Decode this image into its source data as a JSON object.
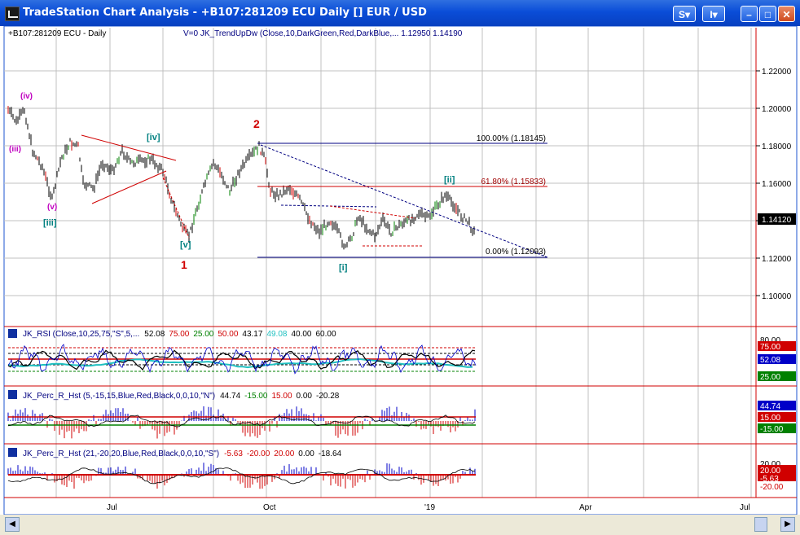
{
  "window": {
    "title": "TradeStation Chart Analysis  - +B107:281209 ECU Daily [] EUR / USD",
    "buttons": {
      "s": "S",
      "i": "I"
    }
  },
  "main_pane": {
    "symbol_label": "+B107:281209 ECU - Daily",
    "indicator_label": "V=0  JK_TrendUpDw (Close,10,DarkGreen,Red,DarkBlue,...  1.12950  1.14190",
    "y_ticks": [
      "1.22000",
      "1.20000",
      "1.18000",
      "1.16000",
      "1.14000",
      "1.12000",
      "1.10000"
    ],
    "last_price": "1.14120",
    "fib": [
      {
        "label": "100.00% (1.18145)",
        "value": 1.18145
      },
      {
        "label": "61.80% (1.15833)",
        "value": 1.15833
      },
      {
        "label": "0.00% (1.12093)",
        "value": 1.12093
      }
    ],
    "wave_labels": {
      "iv_small": "(iv)",
      "iii_small": "(iii)",
      "v_small": "(v)",
      "iii_bracket": "[iii]",
      "iv_bracket": "[iv]",
      "v_bracket": "[v]",
      "one": "1",
      "two": "2",
      "i_bracket": "[i]",
      "ii_bracket": "[ii]"
    }
  },
  "rsi_pane": {
    "label_prefix": "JK_RSI (Close,10,25,75,\"S\",5,...",
    "values": [
      {
        "text": "52.08",
        "color": "#000000"
      },
      {
        "text": "75.00",
        "color": "#d00000"
      },
      {
        "text": "25.00",
        "color": "#008000"
      },
      {
        "text": "50.00",
        "color": "#d00000"
      },
      {
        "text": "43.17",
        "color": "#000000"
      },
      {
        "text": "49.08",
        "color": "#20c0c0"
      },
      {
        "text": "40.00",
        "color": "#000000"
      },
      {
        "text": "60.00",
        "color": "#000000"
      }
    ],
    "right_labels": [
      {
        "text": "80.00",
        "bg": "#ffffff",
        "fg": "#000000"
      },
      {
        "text": "75.00",
        "bg": "#d00000",
        "fg": "#ffffff"
      },
      {
        "text": "52.08",
        "bg": "#0000c8",
        "fg": "#ffffff"
      },
      {
        "text": "25.00",
        "bg": "#008000",
        "fg": "#ffffff"
      }
    ]
  },
  "perc_pane_1": {
    "label_prefix": "JK_Perc_R_Hst (5,-15,15,Blue,Red,Black,0,0,10,\"N\")",
    "values": [
      {
        "text": "44.74",
        "color": "#000000"
      },
      {
        "text": "-15.00",
        "color": "#008000"
      },
      {
        "text": "15.00",
        "color": "#d00000"
      },
      {
        "text": "0.00",
        "color": "#000000"
      },
      {
        "text": "-20.28",
        "color": "#000000"
      }
    ],
    "right_labels": [
      {
        "text": "44.74",
        "bg": "#0000c8",
        "fg": "#ffffff"
      },
      {
        "text": "15.00",
        "bg": "#d00000",
        "fg": "#ffffff"
      },
      {
        "text": "-15.00",
        "bg": "#008000",
        "fg": "#ffffff"
      }
    ]
  },
  "perc_pane_2": {
    "label_prefix": "JK_Perc_R_Hst (21,-20,20,Blue,Red,Black,0,0,10,\"S\")",
    "values": [
      {
        "text": "-5.63",
        "color": "#d00000"
      },
      {
        "text": "-20.00",
        "color": "#d00000"
      },
      {
        "text": "20.00",
        "color": "#d00000"
      },
      {
        "text": "0.00",
        "color": "#000000"
      },
      {
        "text": "-18.64",
        "color": "#000000"
      }
    ],
    "right_labels": [
      {
        "text": "20.00",
        "bg": "#ffffff",
        "fg": "#000000"
      },
      {
        "text": "20.00",
        "bg": "#d00000",
        "fg": "#ffffff"
      },
      {
        "text": "-5.63",
        "bg": "#d00000",
        "fg": "#ffffff"
      },
      {
        "text": "-20.00",
        "bg": "#ffffff",
        "fg": "#d00000"
      }
    ]
  },
  "x_axis": {
    "labels": [
      "Jul",
      "Oct",
      "'19",
      "Apr",
      "Jul"
    ]
  },
  "colors": {
    "up": "#008000",
    "down": "#d00000",
    "bar": "#000000",
    "grid": "#c0c0c0",
    "pane_sep": "#d00000"
  }
}
